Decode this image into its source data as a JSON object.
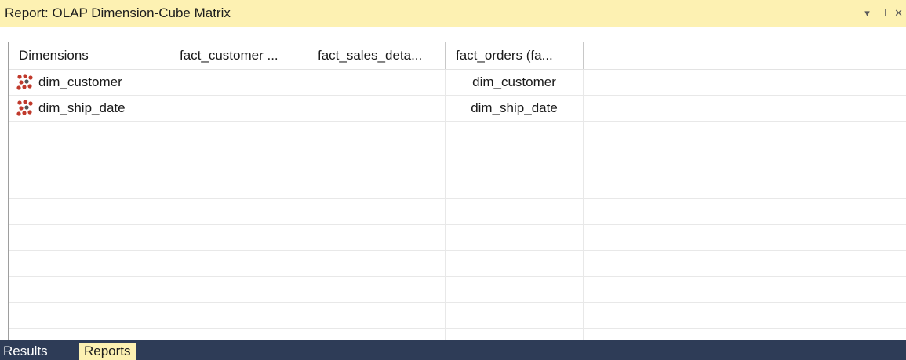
{
  "window": {
    "title": "Report: OLAP Dimension-Cube Matrix",
    "icons": [
      "dropdown-arrow-icon",
      "pin-icon",
      "close-icon"
    ],
    "dropdown_glyph": "▾",
    "pin_glyph": "⊣",
    "close_glyph": "✕"
  },
  "grid": {
    "columns": [
      "Dimensions",
      "fact_customer ...",
      "fact_sales_deta...",
      "fact_orders (fa...",
      ""
    ],
    "rows": [
      {
        "dimension": "dim_customer",
        "fact_customer": "",
        "fact_sales_detail": "",
        "fact_orders": "dim_customer"
      },
      {
        "dimension": "dim_ship_date",
        "fact_customer": "",
        "fact_sales_detail": "",
        "fact_orders": "dim_ship_date"
      },
      {
        "dimension": "",
        "fact_customer": "",
        "fact_sales_detail": "",
        "fact_orders": ""
      },
      {
        "dimension": "",
        "fact_customer": "",
        "fact_sales_detail": "",
        "fact_orders": ""
      },
      {
        "dimension": "",
        "fact_customer": "",
        "fact_sales_detail": "",
        "fact_orders": ""
      },
      {
        "dimension": "",
        "fact_customer": "",
        "fact_sales_detail": "",
        "fact_orders": ""
      },
      {
        "dimension": "",
        "fact_customer": "",
        "fact_sales_detail": "",
        "fact_orders": ""
      },
      {
        "dimension": "",
        "fact_customer": "",
        "fact_sales_detail": "",
        "fact_orders": ""
      },
      {
        "dimension": "",
        "fact_customer": "",
        "fact_sales_detail": "",
        "fact_orders": ""
      },
      {
        "dimension": "",
        "fact_customer": "",
        "fact_sales_detail": "",
        "fact_orders": ""
      },
      {
        "dimension": "",
        "fact_customer": "",
        "fact_sales_detail": "",
        "fact_orders": ""
      }
    ]
  },
  "tabs": {
    "results": "Results",
    "reports": "Reports"
  },
  "colors": {
    "titlebar_bg": "#fdf1b2",
    "tabbar_bg": "#2e3c57",
    "active_tab_bg": "#fdf1b2",
    "dim_icon_red": "#c0392b",
    "dim_icon_dark": "#555555"
  }
}
